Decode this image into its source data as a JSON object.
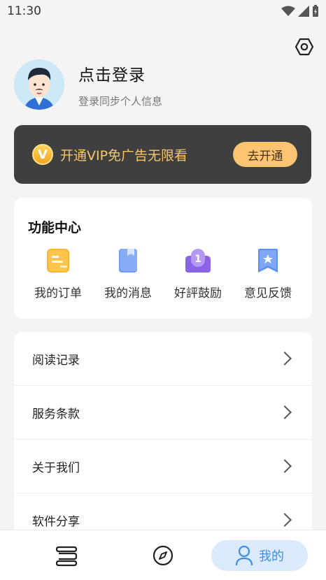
{
  "status_bar": {
    "time": "11:30"
  },
  "profile": {
    "title": "点击登录",
    "subtitle": "登录同步个人信息"
  },
  "vip": {
    "badge": "V",
    "text": "开通VIP免广告无限看",
    "button": "去开通"
  },
  "functions": {
    "title": "功能中心",
    "items": [
      {
        "label": "我的订单",
        "icon": "order-icon"
      },
      {
        "label": "我的消息",
        "icon": "message-icon"
      },
      {
        "label": "好評鼓励",
        "icon": "rating-icon"
      },
      {
        "label": "意见反馈",
        "icon": "feedback-icon"
      }
    ]
  },
  "menu": [
    {
      "label": "阅读记录"
    },
    {
      "label": "服务条款"
    },
    {
      "label": "关于我们"
    },
    {
      "label": "软件分享"
    }
  ],
  "bottom_nav": {
    "items": [
      {
        "icon": "bookshelf-icon"
      },
      {
        "icon": "compass-icon"
      },
      {
        "icon": "user-icon",
        "label": "我的",
        "active": true
      }
    ]
  },
  "colors": {
    "vip_bg": "#3f3f3f",
    "vip_gold": "#fdc571",
    "accent": "#3f8ee8"
  }
}
